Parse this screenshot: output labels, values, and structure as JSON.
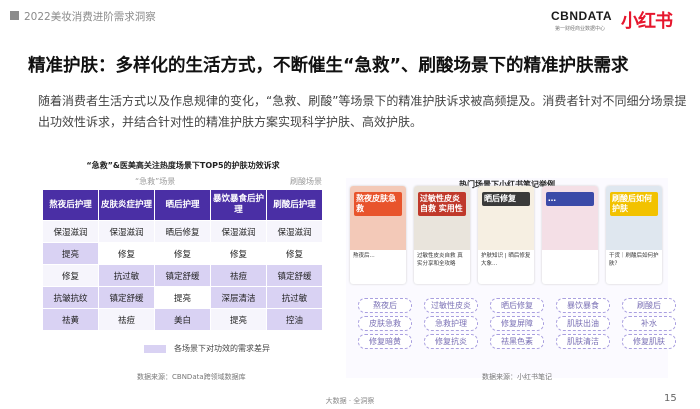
{
  "header": {
    "title": "2022美妆消费进阶需求洞察",
    "logo_cbn": "CBNDATA",
    "logo_cbn_sub": "第一财经商业数据中心",
    "logo_xhs": "小红书"
  },
  "heading": "精准护肤：多样化的生活方式，不断催生“急救”、刷酸场景下的精准护肤需求",
  "body_text": "随着消费者生活方式以及作息规律的变化，“急救、刷酸”等场景下的精准护肤诉求被高频提及。消费者针对不同细分场景提出功效性诉求，并结合针对性的精准护肤方案实现科学护肤、高效护肤。",
  "left_panel": {
    "title": "“急救”&医美高关注热度场景下TOP5的护肤功效诉求",
    "group_labels": [
      "“急救”场景",
      "刷酸场景"
    ],
    "columns": [
      "熬夜后护理",
      "皮肤炎症护理",
      "晒后护理",
      "暴饮暴食后护理",
      "刷酸后护理"
    ],
    "rows": [
      [
        "保湿滋润",
        "保湿滋润",
        "晒后修复",
        "保湿滋润",
        "保湿滋润"
      ],
      [
        "提亮",
        "修复",
        "修复",
        "修复",
        "修复"
      ],
      [
        "修复",
        "抗过敏",
        "镇定舒缓",
        "祛痘",
        "镇定舒缓"
      ],
      [
        "抗皱抗纹",
        "镇定舒缓",
        "提亮",
        "深层清洁",
        "抗过敏"
      ],
      [
        "祛黄",
        "祛痘",
        "美白",
        "提亮",
        "控油"
      ]
    ],
    "legend": "各场景下对功效的需求差异",
    "source": "数据来源：CBNData跨领域数据库"
  },
  "right_panel": {
    "title": "热门场景下小红书笔记举例",
    "cards": [
      {
        "overlay": "熬夜皮肤急救",
        "caption": "熬夜后...",
        "bg": "#f3c9b8",
        "accent": "#e8542c"
      },
      {
        "overlay": "过敏性皮炎 自救 实用性",
        "caption": "过敏性皮炎自救 真实分享和全攻略",
        "bg": "#e9e4dc",
        "accent": "#c0392b"
      },
      {
        "overlay": "晒后修复",
        "caption": "护肤知识 | 晒后修复大象...",
        "bg": "#f6efe2",
        "accent": "#3a3a3a"
      },
      {
        "overlay": "…",
        "caption": "",
        "bg": "#f4dfe6",
        "accent": "#3b4aa8"
      },
      {
        "overlay": "刷酸后如何护肤",
        "caption": "干货｜刷酸后如何护肤？",
        "bg": "#dfe7ef",
        "accent": "#f2c200"
      }
    ],
    "tags": [
      [
        "熬夜后",
        "过敏性皮炎",
        "晒后修复",
        "暴饮暴食",
        "刷酸后"
      ],
      [
        "皮肤急救",
        "急救护理",
        "修复屏障",
        "肌肤出油",
        "补水"
      ],
      [
        "修复暗黄",
        "修复抗炎",
        "祛黑色素",
        "肌肤清洁",
        "修复肌肤"
      ]
    ],
    "source": "数据来源：小红书笔记"
  },
  "footer": {
    "text": "大数据 · 全洞察",
    "page": "15"
  }
}
